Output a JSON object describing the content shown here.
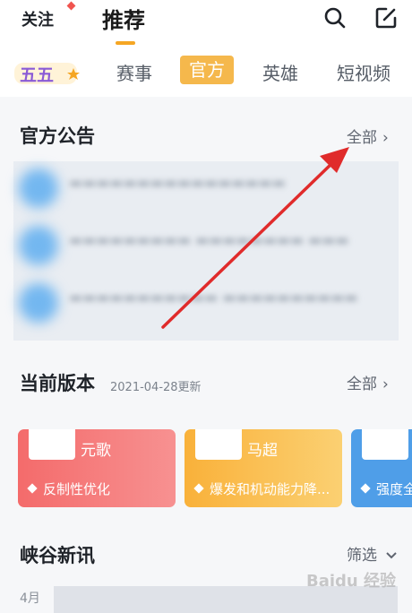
{
  "top_nav": {
    "follow": "关注",
    "recommend": "推荐"
  },
  "channels": {
    "logo": "五五",
    "tabs": [
      "赛事",
      "官方",
      "英雄",
      "短视频"
    ],
    "active": "官方"
  },
  "announcements": {
    "title": "官方公告",
    "more": "全部"
  },
  "version": {
    "title": "当前版本",
    "date": "2021-04-28更新",
    "more": "全部"
  },
  "hero_cards": [
    {
      "hero": "元歌",
      "note": "反制性优化",
      "color": "#f46b6b"
    },
    {
      "hero": "马超",
      "note": "爆发和机动能力降...",
      "color": "#f9b13a"
    },
    {
      "hero": "",
      "note": "强度全",
      "color": "#4f9ee8"
    }
  ],
  "news": {
    "title": "峡谷新讯",
    "filter": "筛选",
    "month": "4月"
  },
  "watermark": "Baidu 经验",
  "colors": {
    "accent": "#f5a623",
    "arrow": "#e02b2b"
  }
}
